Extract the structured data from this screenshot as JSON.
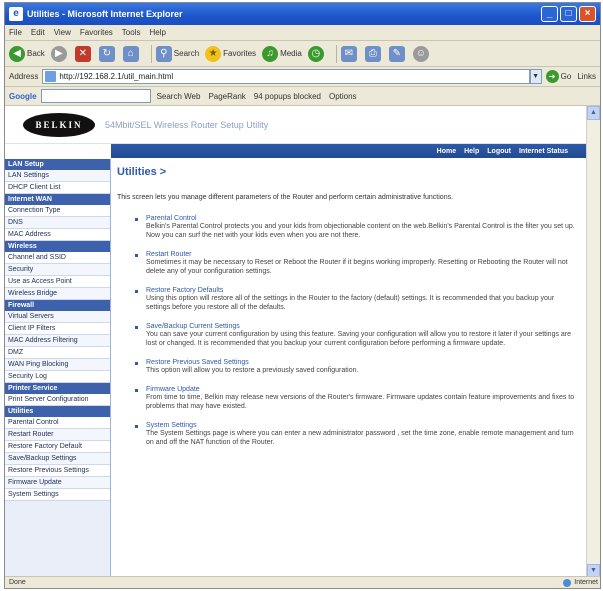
{
  "window": {
    "title": "Utilities - Microsoft Internet Explorer",
    "min": "_",
    "max": "□",
    "close": "×"
  },
  "menu": [
    "File",
    "Edit",
    "View",
    "Favorites",
    "Tools",
    "Help"
  ],
  "toolbar": {
    "back": "Back",
    "search": "Search",
    "favorites": "Favorites",
    "media": "Media"
  },
  "address": {
    "label": "Address",
    "value": "http://192.168.2.1/util_main.html",
    "go": "Go",
    "links": "Links"
  },
  "googlebar": {
    "logo": "Google",
    "search_web": "Search Web",
    "pagerank": "PageRank",
    "blocked": "94 popups blocked",
    "options": "Options"
  },
  "header": {
    "logo": "BELKIN",
    "product": "54Mbit/SEL Wireless Router Setup Utility",
    "nav": [
      "Home",
      "Help",
      "Logout",
      "Internet Status"
    ]
  },
  "sidebar": [
    {
      "type": "head",
      "label": "LAN Setup"
    },
    {
      "type": "item",
      "label": "LAN Settings"
    },
    {
      "type": "item",
      "label": "DHCP Client List"
    },
    {
      "type": "head",
      "label": "Internet WAN"
    },
    {
      "type": "item",
      "label": "Connection Type"
    },
    {
      "type": "item",
      "label": "DNS"
    },
    {
      "type": "item",
      "label": "MAC Address"
    },
    {
      "type": "head",
      "label": "Wireless"
    },
    {
      "type": "item",
      "label": "Channel and SSID"
    },
    {
      "type": "item",
      "label": "Security"
    },
    {
      "type": "item",
      "label": "Use as Access Point"
    },
    {
      "type": "item",
      "label": "Wireless Bridge"
    },
    {
      "type": "head",
      "label": "Firewall"
    },
    {
      "type": "item",
      "label": "Virtual Servers"
    },
    {
      "type": "item",
      "label": "Client IP Filters"
    },
    {
      "type": "item",
      "label": "MAC Address Filtering"
    },
    {
      "type": "item",
      "label": "DMZ"
    },
    {
      "type": "item",
      "label": "WAN Ping Blocking"
    },
    {
      "type": "item",
      "label": "Security Log"
    },
    {
      "type": "head",
      "label": "Printer Service"
    },
    {
      "type": "item",
      "label": "Print Server Configuration"
    },
    {
      "type": "head",
      "label": "Utilities"
    },
    {
      "type": "item",
      "label": "Parental Control"
    },
    {
      "type": "item",
      "label": "Restart Router"
    },
    {
      "type": "item",
      "label": "Restore Factory Default"
    },
    {
      "type": "item",
      "label": "Save/Backup Settings"
    },
    {
      "type": "item",
      "label": "Restore Previous Settings"
    },
    {
      "type": "item",
      "label": "Firmware Update"
    },
    {
      "type": "item",
      "label": "System Settings"
    }
  ],
  "main": {
    "title": "Utilities >",
    "intro": "This screen lets you manage different parameters of the Router and perform certain administrative functions.",
    "utilities": [
      {
        "title": "Parental Control",
        "desc": "Belkin's Parental Control protects you and your kids from objectionable content on the web.Belkin's Parental Control is the filter you set up. Now you can surf the net with your kids even when you are not there."
      },
      {
        "title": "Restart Router",
        "desc": "Sometimes it may be necessary to Reset or Reboot the Router if it begins working improperly. Resetting or Rebooting the Router will not delete any of your configuration settings."
      },
      {
        "title": "Restore Factory Defaults",
        "desc": "Using this option will restore all of the settings in the Router to the factory (default) settings. It is recommended that you backup your settings before you restore all of the defaults."
      },
      {
        "title": "Save/Backup Current Settings",
        "desc": "You can save your current configuration by using this feature. Saving your configuration will allow you to restore it later if your settings are lost or changed. It is recommended that you backup your current configuration before performing a firmware update."
      },
      {
        "title": "Restore Previous Saved Settings",
        "desc": "This option will allow you to restore a previously saved configuration."
      },
      {
        "title": "Firmware Update",
        "desc": "From time to time, Belkin may release new versions of the Router's firmware. Firmware updates contain feature improvements and fixes to problems that may have existed."
      },
      {
        "title": "System Settings",
        "desc": "The System Settings page is where you can enter a new administrator password , set the time zone, enable remote management and turn on and off the NAT function of the Router."
      }
    ]
  },
  "status": {
    "left": "Done",
    "right": "Internet"
  }
}
